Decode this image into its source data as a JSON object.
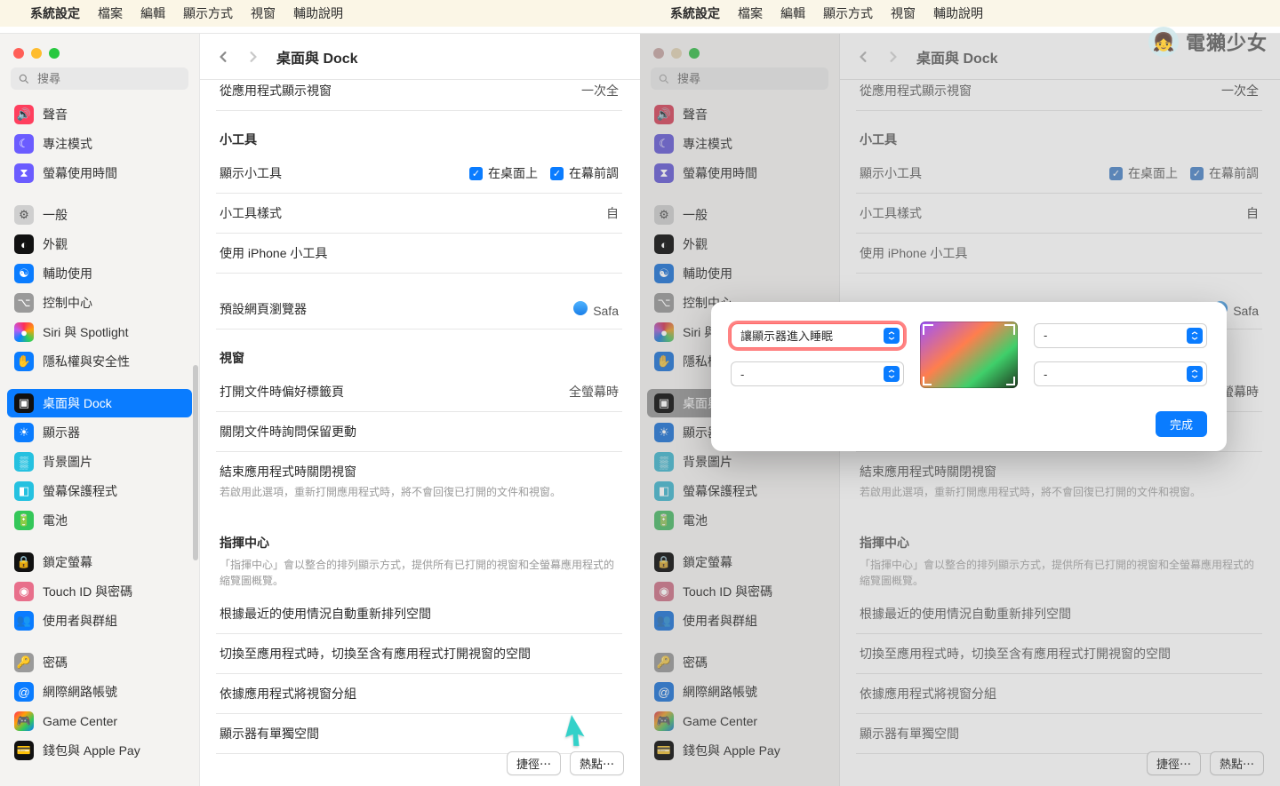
{
  "menubar": {
    "app": "系統設定",
    "items": [
      "檔案",
      "編輯",
      "顯示方式",
      "視窗",
      "輔助說明"
    ]
  },
  "search_placeholder": "搜尋",
  "sidebar": [
    {
      "label": "聲音",
      "color": "#ff3f5e",
      "glyph": "🔊"
    },
    {
      "label": "專注模式",
      "color": "#6b5cff",
      "glyph": "☾"
    },
    {
      "label": "螢幕使用時間",
      "color": "#6b5cff",
      "glyph": "⧗"
    },
    {
      "gap": true
    },
    {
      "label": "一般",
      "color": "#cfcfcf",
      "glyph": "⚙",
      "dark": true
    },
    {
      "label": "外觀",
      "color": "#111",
      "glyph": "◐"
    },
    {
      "label": "輔助使用",
      "color": "#0a7cff",
      "glyph": "☯"
    },
    {
      "label": "控制中心",
      "color": "#9a9a9a",
      "glyph": "⌥"
    },
    {
      "label": "Siri 與 Spotlight",
      "color": "#111",
      "glyph": "●",
      "siri": true
    },
    {
      "label": "隱私權與安全性",
      "color": "#0a7cff",
      "glyph": "✋"
    },
    {
      "gap": true
    },
    {
      "label": "桌面與 Dock",
      "color": "#111",
      "glyph": "▣",
      "selected": true
    },
    {
      "label": "顯示器",
      "color": "#0a7cff",
      "glyph": "☀"
    },
    {
      "label": "背景圖片",
      "color": "#25c1e0",
      "glyph": "▒"
    },
    {
      "label": "螢幕保護程式",
      "color": "#25c1e0",
      "glyph": "◧"
    },
    {
      "label": "電池",
      "color": "#34c759",
      "glyph": "🔋"
    },
    {
      "gap": true
    },
    {
      "label": "鎖定螢幕",
      "color": "#111",
      "glyph": "🔒"
    },
    {
      "label": "Touch ID 與密碼",
      "color": "#e86f8b",
      "glyph": "◉"
    },
    {
      "label": "使用者與群組",
      "color": "#0a7cff",
      "glyph": "👥"
    },
    {
      "gap": true
    },
    {
      "label": "密碼",
      "color": "#9a9a9a",
      "glyph": "🔑"
    },
    {
      "label": "網際網路帳號",
      "color": "#0a7cff",
      "glyph": "@"
    },
    {
      "label": "Game Center",
      "color": "#ffffff",
      "glyph": "🎮",
      "multi": true
    },
    {
      "label": "錢包與 Apple Pay",
      "color": "#111",
      "glyph": "💳"
    }
  ],
  "page_title": "桌面與 Dock",
  "overscroll_row": {
    "label": "從應用程式顯示視窗",
    "value": "一次全"
  },
  "widgets": {
    "header": "小工具",
    "show": {
      "label": "顯示小工具",
      "desktop": "在桌面上",
      "stage": "在幕前調"
    },
    "style": {
      "label": "小工具樣式",
      "value": "自"
    },
    "iphone": "使用 iPhone 小工具"
  },
  "browser": {
    "label": "預設網頁瀏覽器",
    "value": "Safa"
  },
  "windows": {
    "header": "視窗",
    "tabs": {
      "label": "打開文件時偏好標籤頁",
      "value": "全螢幕時"
    },
    "ask": "關閉文件時詢問保留更動",
    "close": {
      "label": "結束應用程式時關閉視窗",
      "sub": "若啟用此選項，重新打開應用程式時，將不會回復已打開的文件和視窗。"
    }
  },
  "mc": {
    "header": "指揮中心",
    "sub": "「指揮中心」會以整合的排列顯示方式，提供所有已打開的視窗和全螢幕應用程式的縮覽圖概覽。",
    "rows": [
      "根據最近的使用情況自動重新排列空間",
      "切換至應用程式時，切換至含有應用程式打開視窗的空間",
      "依據應用程式將視窗分組",
      "顯示器有單獨空間"
    ]
  },
  "footer": {
    "shortcuts": "捷徑⋯",
    "hotcorners": "熱點⋯"
  },
  "sheet": {
    "tl": "讓顯示器進入睡眠",
    "tr": "-",
    "bl": "-",
    "br": "-",
    "done": "完成"
  },
  "watermark": "電獺少女"
}
